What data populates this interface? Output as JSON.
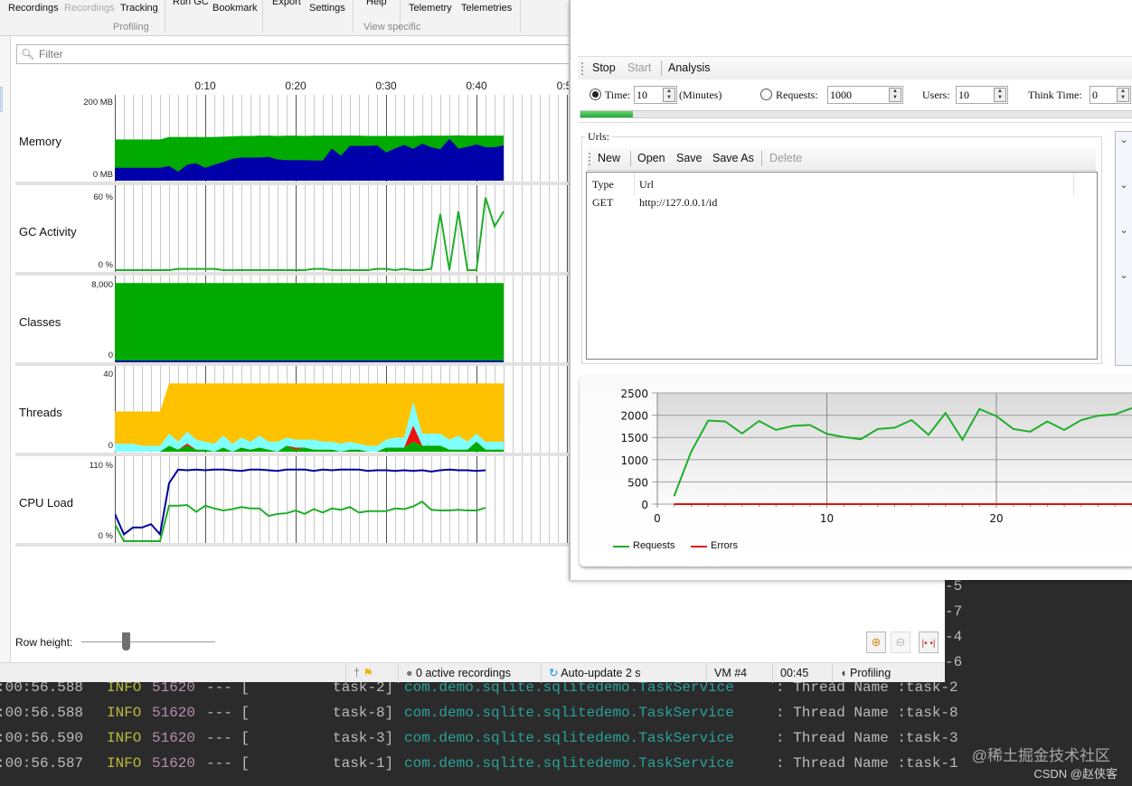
{
  "ribbon": {
    "buttons": [
      {
        "label": "Recordings",
        "enabled": true
      },
      {
        "label": "Recordings",
        "enabled": false
      },
      {
        "label": "Tracking",
        "enabled": true
      },
      {
        "label": "Run GC",
        "enabled": true
      },
      {
        "label": "Bookmark",
        "enabled": true
      },
      {
        "label": "Export",
        "enabled": true
      },
      {
        "label": "Settings",
        "enabled": true
      },
      {
        "label": "Help",
        "enabled": true
      },
      {
        "label": "Telemetry",
        "enabled": true
      },
      {
        "label": "Telemetries",
        "enabled": true
      }
    ],
    "groups": [
      "Profiling",
      "View specific"
    ]
  },
  "filter": {
    "placeholder": "Filter",
    "value": ""
  },
  "timeline": {
    "ticks": [
      "0:10",
      "0:20",
      "0:30",
      "0:40",
      "0:5"
    ]
  },
  "telemetries": [
    {
      "name": "Memory",
      "max_label": "200 MB",
      "min_label": "0 MB"
    },
    {
      "name": "GC Activity",
      "max_label": "60 %",
      "min_label": "0 %"
    },
    {
      "name": "Classes",
      "max_label": "8,000",
      "min_label": "0"
    },
    {
      "name": "Threads",
      "max_label": "40",
      "min_label": "0"
    },
    {
      "name": "CPU Load",
      "max_label": "110 %",
      "min_label": "0 %"
    }
  ],
  "telemetry_series": {
    "memory_heap_used_mb": [
      40,
      40,
      40,
      40,
      40,
      40,
      46,
      28,
      50,
      54,
      40,
      50,
      58,
      68,
      72,
      72,
      72,
      74,
      66,
      64,
      64,
      64,
      63,
      63,
      100,
      78,
      108,
      108,
      108,
      110,
      88,
      100,
      111,
      99,
      115,
      104,
      98,
      130,
      100,
      105,
      113,
      104,
      104,
      110
    ],
    "memory_heap_committed_mb": [
      128,
      128,
      128,
      128,
      128,
      128,
      136,
      136,
      136,
      136,
      136,
      136,
      137,
      138,
      139,
      139,
      140,
      140,
      139,
      140,
      140,
      139,
      140,
      140,
      140,
      140,
      140,
      140,
      139,
      139,
      139,
      139,
      139,
      139,
      140,
      140,
      140,
      140,
      141,
      140,
      140,
      140,
      140,
      140
    ],
    "gc_activity_pct": [
      0,
      0,
      0,
      0,
      0,
      0,
      0,
      1,
      1,
      1,
      1,
      1,
      0,
      0,
      0,
      0,
      0,
      0,
      0,
      0,
      0,
      0,
      1,
      1,
      0,
      0,
      0,
      0,
      0,
      1,
      1,
      0,
      1,
      0,
      0,
      1,
      45,
      0,
      47,
      0,
      0,
      58,
      35,
      47
    ],
    "classes_loaded": [
      7800,
      7800,
      7800,
      7800,
      7800,
      7800,
      7800,
      7800,
      7800,
      7800,
      7800,
      7800,
      7800,
      7800,
      7800,
      7800,
      7800,
      7800,
      7800,
      7800,
      7800,
      7800,
      7800,
      7800,
      7800,
      7800,
      7800,
      7800,
      7800,
      7800,
      7800,
      7800,
      7800,
      7800,
      7800,
      7800,
      7800,
      7800,
      7800,
      7800,
      7800,
      7800,
      7800,
      7800
    ],
    "threads_total": [
      20,
      20,
      20,
      20,
      20,
      20,
      34,
      34,
      34,
      34,
      34,
      34,
      34,
      34,
      34,
      34,
      34,
      34,
      34,
      34,
      34,
      34,
      34,
      34,
      34,
      34,
      34,
      34,
      34,
      34,
      34,
      34,
      34,
      34,
      34,
      34,
      34,
      34,
      34,
      34,
      34,
      34,
      34,
      34
    ],
    "threads_waiting": [
      4,
      4,
      4,
      3,
      3,
      3,
      6,
      4,
      6,
      5,
      4,
      4,
      6,
      4,
      5,
      4,
      6,
      4,
      5,
      4,
      4,
      4,
      5,
      4,
      4,
      4,
      4,
      3,
      3,
      3,
      4,
      5,
      5,
      12,
      6,
      6,
      6,
      5,
      7,
      4,
      4,
      4,
      4,
      4
    ],
    "threads_runnable": [
      0,
      0,
      0,
      0,
      0,
      0,
      3,
      1,
      3,
      1,
      1,
      0,
      2,
      0,
      2,
      1,
      2,
      1,
      0,
      3,
      1,
      2,
      1,
      1,
      1,
      0,
      1,
      1,
      0,
      0,
      2,
      2,
      2,
      5,
      3,
      3,
      3,
      1,
      1,
      1,
      5,
      1,
      1,
      1
    ],
    "threads_blocked": [
      0,
      0,
      0,
      0,
      0,
      0,
      0,
      0,
      1,
      0,
      0,
      0,
      0,
      0,
      0,
      0,
      0,
      0,
      0,
      0,
      1,
      0,
      0,
      0,
      0,
      0,
      0,
      0,
      0,
      0,
      0,
      0,
      0,
      8,
      0,
      0,
      0,
      0,
      0,
      0,
      0,
      0,
      0,
      0
    ],
    "cpu_process_pct": [
      40,
      10,
      20,
      20,
      25,
      10,
      85,
      105,
      104,
      105,
      104,
      105,
      105,
      104,
      103,
      105,
      105,
      104,
      103,
      105,
      105,
      105,
      103,
      105,
      104,
      105,
      105,
      105,
      103,
      104,
      104,
      103,
      104,
      103,
      104,
      102,
      104,
      105,
      104,
      104,
      103,
      104
    ],
    "cpu_system_pct": [
      25,
      0,
      0,
      0,
      0,
      0,
      52,
      52,
      53,
      43,
      52,
      48,
      45,
      47,
      50,
      48,
      48,
      37,
      40,
      41,
      45,
      40,
      47,
      42,
      48,
      46,
      50,
      42,
      44,
      44,
      44,
      48,
      47,
      51,
      58,
      46,
      45,
      45,
      46,
      45,
      45,
      49
    ]
  },
  "row_height": {
    "label": "Row height:",
    "value_fraction": 0.33
  },
  "statusbar": {
    "recordings": "0 active recordings",
    "auto_update": "Auto-update 2 s",
    "vm": "VM #4",
    "elapsed": "00:45",
    "mode": "Profiling"
  },
  "loadtest": {
    "toolbar": {
      "stop": "Stop",
      "start": "Start",
      "analysis": "Analysis"
    },
    "params": {
      "mode_selected": "time",
      "time_label": "Time:",
      "time_value": "10",
      "time_unit": "(Minutes)",
      "requests_label": "Requests:",
      "requests_value": "1000",
      "users_label": "Users:",
      "users_value": "10",
      "think_label": "Think Time:",
      "think_value": "0"
    },
    "progress_fraction": 0.095,
    "urls": {
      "title": "Urls:",
      "toolbar": {
        "new": "New",
        "open": "Open",
        "save": "Save",
        "save_as": "Save As",
        "delete": "Delete"
      },
      "columns": [
        "Type",
        "Url"
      ],
      "rows": [
        {
          "type": "GET",
          "url": "http://127.0.0.1/id"
        }
      ]
    }
  },
  "chart_data": {
    "type": "line",
    "title": "",
    "xlabel": "",
    "ylabel": "",
    "xlim": [
      0,
      28
    ],
    "ylim": [
      0,
      2500
    ],
    "x_ticks": [
      0,
      10,
      20
    ],
    "y_ticks": [
      0,
      500,
      1000,
      1500,
      2000,
      2500
    ],
    "grid": true,
    "legend": "bottom-left",
    "x": [
      1,
      2,
      3,
      4,
      5,
      6,
      7,
      8,
      9,
      10,
      11,
      12,
      13,
      14,
      15,
      16,
      17,
      18,
      19,
      20,
      21,
      22,
      23,
      24,
      25,
      26,
      27,
      28
    ],
    "series": [
      {
        "name": "Requests",
        "color": "#1fae2a",
        "values": [
          190,
          1180,
          1880,
          1860,
          1590,
          1870,
          1670,
          1760,
          1780,
          1580,
          1510,
          1460,
          1690,
          1720,
          1890,
          1560,
          2050,
          1450,
          2140,
          1980,
          1690,
          1630,
          1860,
          1670,
          1890,
          1990,
          2020,
          2160
        ]
      },
      {
        "name": "Errors",
        "color": "#dd1111",
        "values": [
          0,
          0,
          0,
          0,
          0,
          0,
          0,
          0,
          0,
          0,
          0,
          0,
          0,
          0,
          0,
          0,
          0,
          0,
          0,
          0,
          0,
          0,
          0,
          0,
          0,
          0,
          0,
          0
        ]
      }
    ]
  },
  "console": {
    "lines": [
      {
        "time": ":00:56.588",
        "level": "INFO",
        "pid": "51620",
        "sep": "--- [",
        "thread": "task-2]",
        "logger": "com.demo.sqlite.sqlitedemo.TaskService",
        "msg": ": Thread Name :task-2"
      },
      {
        "time": ":00:56.588",
        "level": "INFO",
        "pid": "51620",
        "sep": "--- [",
        "thread": "task-8]",
        "logger": "com.demo.sqlite.sqlitedemo.TaskService",
        "msg": ": Thread Name :task-8"
      },
      {
        "time": ":00:56.590",
        "level": "INFO",
        "pid": "51620",
        "sep": "--- [",
        "thread": "task-3]",
        "logger": "com.demo.sqlite.sqlitedemo.TaskService",
        "msg": ": Thread Name :task-3"
      },
      {
        "time": ":00:56.587",
        "level": "INFO",
        "pid": "51620",
        "sep": "--- [",
        "thread": "task-1]",
        "logger": "com.demo.sqlite.sqlitedemo.TaskService",
        "msg": ": Thread Name :task-1"
      }
    ],
    "right_fragments": [
      "-5",
      "-7",
      "-4",
      "-6"
    ]
  },
  "watermark": {
    "line1": "@稀土掘金技术社区",
    "line2": "CSDN @赵侠客"
  }
}
